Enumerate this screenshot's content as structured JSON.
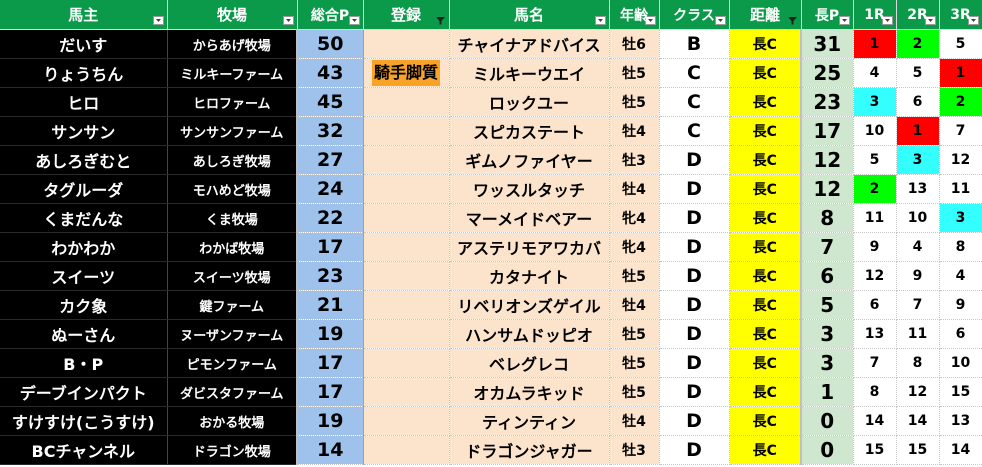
{
  "headers": [
    "馬主",
    "牧場",
    "総合P",
    "登録",
    "馬名",
    "年齢",
    "クラス",
    "距離",
    "長P",
    "1R",
    "2R",
    "3R"
  ],
  "rows": [
    {
      "owner": "だいす",
      "farm": "からあげ牧場",
      "total": "50",
      "reg": "",
      "horse": "チャイナアドバイス",
      "age": "牡6",
      "cls": "B",
      "dist": "長C",
      "longp": "31",
      "r1": "1",
      "r2": "2",
      "r3": "5"
    },
    {
      "owner": "りょうちん",
      "farm": "ミルキーファーム",
      "total": "43",
      "reg": "騎手脚質",
      "horse": "ミルキーウエイ",
      "age": "牡5",
      "cls": "C",
      "dist": "長C",
      "longp": "25",
      "r1": "4",
      "r2": "5",
      "r3": "1"
    },
    {
      "owner": "ヒロ",
      "farm": "ヒロファーム",
      "total": "45",
      "reg": "",
      "horse": "ロックユー",
      "age": "牡5",
      "cls": "C",
      "dist": "長C",
      "longp": "23",
      "r1": "3",
      "r2": "6",
      "r3": "2"
    },
    {
      "owner": "サンサン",
      "farm": "サンサンファーム",
      "total": "32",
      "reg": "",
      "horse": "スピカステート",
      "age": "牡4",
      "cls": "C",
      "dist": "長C",
      "longp": "17",
      "r1": "10",
      "r2": "1",
      "r3": "7"
    },
    {
      "owner": "あしろぎむと",
      "farm": "あしろぎ牧場",
      "total": "27",
      "reg": "",
      "horse": "ギムノファイヤー",
      "age": "牡3",
      "cls": "D",
      "dist": "長C",
      "longp": "12",
      "r1": "5",
      "r2": "3",
      "r3": "12"
    },
    {
      "owner": "タグルーダ",
      "farm": "モハめど牧場",
      "total": "24",
      "reg": "",
      "horse": "ワッスルタッチ",
      "age": "牡4",
      "cls": "D",
      "dist": "長C",
      "longp": "12",
      "r1": "2",
      "r2": "13",
      "r3": "11"
    },
    {
      "owner": "くまだんな",
      "farm": "くま牧場",
      "total": "22",
      "reg": "",
      "horse": "マーメイドベアー",
      "age": "牝4",
      "cls": "D",
      "dist": "長C",
      "longp": "8",
      "r1": "11",
      "r2": "10",
      "r3": "3"
    },
    {
      "owner": "わかわか",
      "farm": "わかば牧場",
      "total": "17",
      "reg": "",
      "horse": "アステリモアワカバ",
      "age": "牝4",
      "cls": "D",
      "dist": "長C",
      "longp": "7",
      "r1": "9",
      "r2": "4",
      "r3": "8"
    },
    {
      "owner": "スイーツ",
      "farm": "スイーツ牧場",
      "total": "23",
      "reg": "",
      "horse": "カタナイト",
      "age": "牡5",
      "cls": "D",
      "dist": "長C",
      "longp": "6",
      "r1": "12",
      "r2": "9",
      "r3": "4"
    },
    {
      "owner": "カク象",
      "farm": "鍵ファーム",
      "total": "21",
      "reg": "",
      "horse": "リベリオンズゲイル",
      "age": "牡4",
      "cls": "D",
      "dist": "長C",
      "longp": "5",
      "r1": "6",
      "r2": "7",
      "r3": "9"
    },
    {
      "owner": "ぬーさん",
      "farm": "ヌーザンファーム",
      "total": "19",
      "reg": "",
      "horse": "ハンサムドッピオ",
      "age": "牡5",
      "cls": "D",
      "dist": "長C",
      "longp": "3",
      "r1": "13",
      "r2": "11",
      "r3": "6"
    },
    {
      "owner": "B・P",
      "farm": "ピモンファーム",
      "total": "17",
      "reg": "",
      "horse": "ベレグレコ",
      "age": "牡5",
      "cls": "D",
      "dist": "長C",
      "longp": "3",
      "r1": "7",
      "r2": "8",
      "r3": "10"
    },
    {
      "owner": "デーブインパクト",
      "farm": "ダビスタファーム",
      "total": "17",
      "reg": "",
      "horse": "オカムラキッド",
      "age": "牡5",
      "cls": "D",
      "dist": "長C",
      "longp": "1",
      "r1": "8",
      "r2": "12",
      "r3": "15"
    },
    {
      "owner": "すけすけ(こうすけ)",
      "farm": "おかる牧場",
      "total": "19",
      "reg": "",
      "horse": "ティンティン",
      "age": "牡4",
      "cls": "D",
      "dist": "長C",
      "longp": "0",
      "r1": "14",
      "r2": "14",
      "r3": "13"
    },
    {
      "owner": "BCチャンネル",
      "farm": "ドラゴン牧場",
      "total": "14",
      "reg": "",
      "horse": "ドラゴンジャガー",
      "age": "牡3",
      "cls": "D",
      "dist": "長C",
      "longp": "0",
      "r1": "15",
      "r2": "15",
      "r3": "14"
    }
  ],
  "highlights": {
    "0": {
      "r1": "red",
      "r2": "green"
    },
    "1": {
      "r3": "red"
    },
    "2": {
      "r1": "cyan",
      "r3": "green"
    },
    "3": {
      "r2": "red"
    },
    "4": {
      "r2": "cyan"
    },
    "5": {
      "r1": "green"
    },
    "6": {
      "r3": "cyan"
    }
  },
  "colors": {
    "header_bg": "#0a9a49",
    "owner_bg": "#000000",
    "total_bg": "#9ec2ec",
    "reg_bg": "#fbe3cc",
    "badge_bg": "#f8a227",
    "dist_bg": "#ffff00",
    "longp_bg": "#cfe7cf",
    "first_place": "#ff0000",
    "second_place": "#00ff00",
    "third_place": "#33ffff"
  },
  "icons": {
    "filter": "filter-dropdown-icon",
    "filter_active": "filter-funnel-icon"
  }
}
